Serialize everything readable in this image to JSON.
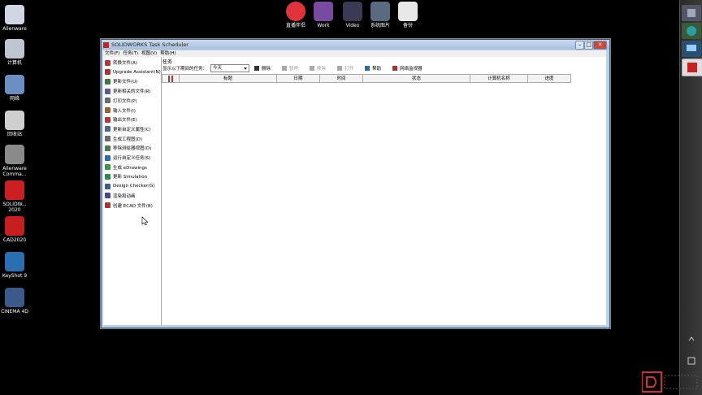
{
  "desktop": {
    "left_icons": [
      {
        "label": "Alienware",
        "icon": "alienware-icon",
        "color": "#d0d6e4"
      },
      {
        "label": "计算机",
        "icon": "computer-icon",
        "color": "#bfc6d2"
      },
      {
        "label": "网络",
        "icon": "network-icon",
        "color": "#6c8fc2"
      },
      {
        "label": "回收站",
        "icon": "recycle-bin-icon",
        "color": "#cfcfcf"
      },
      {
        "label": "Alienware Comma...",
        "icon": "alienware-command-icon",
        "color": "#8a8a8a"
      },
      {
        "label": "SOLIDW... 2020",
        "icon": "solidworks-icon",
        "color": "#cc2020"
      },
      {
        "label": "CAD2020",
        "icon": "autocad-icon",
        "color": "#c81e1e"
      },
      {
        "label": "KeyShot 9",
        "icon": "keyshot-icon",
        "color": "#2a6fb0"
      },
      {
        "label": "CINEMA 4D",
        "icon": "cinema4d-icon",
        "color": "#3a5a8a"
      }
    ],
    "top_icons": [
      {
        "label": "直播伴侣",
        "icon": "live-companion-icon",
        "color": "#e2323a"
      },
      {
        "label": "Work",
        "icon": "work-folder-icon",
        "color": "#7a4aa0"
      },
      {
        "label": "Video",
        "icon": "video-icon",
        "color": "#3a3a55"
      },
      {
        "label": "系统图片",
        "icon": "pictures-icon",
        "color": "#5a6a80"
      },
      {
        "label": "备份",
        "icon": "text-file-icon",
        "color": "#e8e8e8"
      }
    ]
  },
  "window": {
    "title": "SOLIDWORKS Task Scheduler",
    "menu": [
      "文件(F)",
      "任务(T)",
      "视图(V)",
      "帮助(H)"
    ],
    "tasks": [
      {
        "label": "转换文件(A)",
        "icon": "convert-files-icon",
        "color": "#c0303a"
      },
      {
        "label": "Upgrade Assistant(N)",
        "icon": "upgrade-assistant-icon",
        "color": "#b03030"
      },
      {
        "label": "更新文件(U)",
        "icon": "update-files-icon",
        "color": "#3a7a3a"
      },
      {
        "label": "更新相关的文件(R)",
        "icon": "update-related-icon",
        "color": "#5a5a9a"
      },
      {
        "label": "打印文件(P)",
        "icon": "print-files-icon",
        "color": "#6a6a6a"
      },
      {
        "label": "输入文件(I)",
        "icon": "import-files-icon",
        "color": "#a06020"
      },
      {
        "label": "输出文件(E)",
        "icon": "export-files-icon",
        "color": "#c0303a"
      },
      {
        "label": "更新自定义属性(C)",
        "icon": "custom-properties-icon",
        "color": "#4a6a9a"
      },
      {
        "label": "生成工程图(D)",
        "icon": "drawing-icon",
        "color": "#6a6a6a"
      },
      {
        "label": "移除测绘器视图(O)",
        "icon": "remove-view-icon",
        "color": "#4a7a4a"
      },
      {
        "label": "运行自定义任务(S)",
        "icon": "custom-task-icon",
        "color": "#2a6ab0"
      },
      {
        "label": "生成 eDrawings",
        "icon": "edrawings-icon",
        "color": "#3a9a3a"
      },
      {
        "label": "更新 Simulation",
        "icon": "simulation-icon",
        "color": "#2a8a4a"
      },
      {
        "label": "Design Checker(G)",
        "icon": "design-checker-icon",
        "color": "#3a5a9a"
      },
      {
        "label": "渲染和动画",
        "icon": "render-icon",
        "color": "#4a4a8a"
      },
      {
        "label": "创建 ECAD 文件(B)",
        "icon": "ecad-icon",
        "color": "#b03030"
      }
    ],
    "panel_title": "任务",
    "filter_label": "显示以下期间的任务：",
    "filter_value": "今天",
    "toolbar": [
      {
        "label": "删除",
        "icon": "delete-icon",
        "color": "#333333",
        "enabled": true
      },
      {
        "label": "暂停",
        "icon": "pause-icon",
        "color": "#aaaaaa",
        "enabled": false
      },
      {
        "label": "移除",
        "icon": "remove-icon",
        "color": "#aaaaaa",
        "enabled": false
      },
      {
        "label": "打开",
        "icon": "open-icon",
        "color": "#aaaaaa",
        "enabled": false
      },
      {
        "label": "帮助",
        "icon": "help-icon",
        "color": "#2a6ab0",
        "enabled": true
      },
      {
        "label": "网络监视器",
        "icon": "network-monitor-icon",
        "color": "#b03030",
        "enabled": true
      }
    ],
    "columns": [
      "标题",
      "日期",
      "时间",
      "状态",
      "计算机名称",
      "进度"
    ]
  }
}
